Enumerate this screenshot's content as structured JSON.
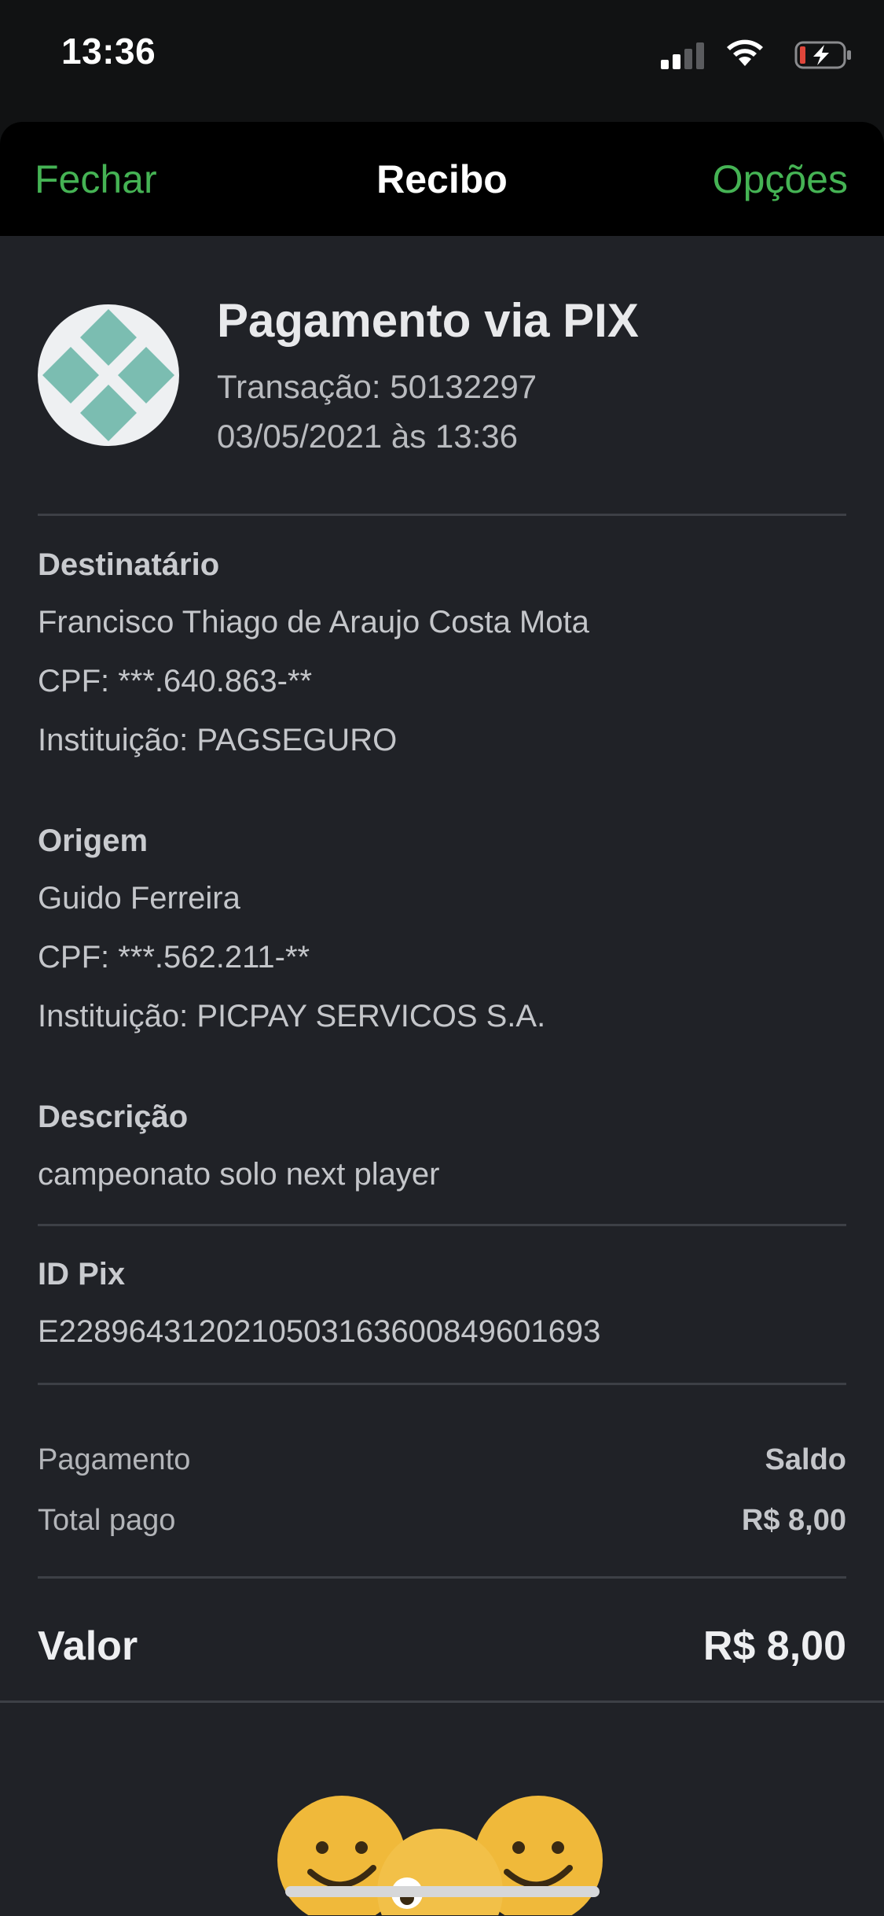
{
  "status_bar": {
    "time": "13:36",
    "icons": [
      "signal-icon",
      "wifi-icon",
      "battery-charging-icon"
    ]
  },
  "nav": {
    "close_label": "Fechar",
    "title": "Recibo",
    "options_label": "Opções"
  },
  "header": {
    "icon": "pix-logo-icon",
    "title": "Pagamento via PIX",
    "transaction": "Transação: 50132297",
    "datetime": "03/05/2021 às 13:36"
  },
  "recipient": {
    "label": "Destinatário",
    "name": "Francisco Thiago de Araujo Costa Mota",
    "cpf": "CPF: ***.640.863-**",
    "institution": "Instituição: PAGSEGURO"
  },
  "origin": {
    "label": "Origem",
    "name": "Guido Ferreira",
    "cpf": "CPF: ***.562.211-**",
    "institution": "Instituição: PICPAY SERVICOS S.A."
  },
  "description": {
    "label": "Descrição",
    "text": "campeonato solo next player"
  },
  "pix_id": {
    "label": "ID Pix",
    "value": "E22896431202105031636008496016​93"
  },
  "payment": {
    "method_label": "Pagamento",
    "method_value": "Saldo",
    "total_label": "Total pago",
    "total_value": "R$ 8,00"
  },
  "amount": {
    "label": "Valor",
    "value": "R$ 8,00"
  },
  "colors": {
    "accent": "#45b354",
    "background": "#202227",
    "nav_background": "#000000",
    "pix_logo": "#7bbdb1"
  }
}
